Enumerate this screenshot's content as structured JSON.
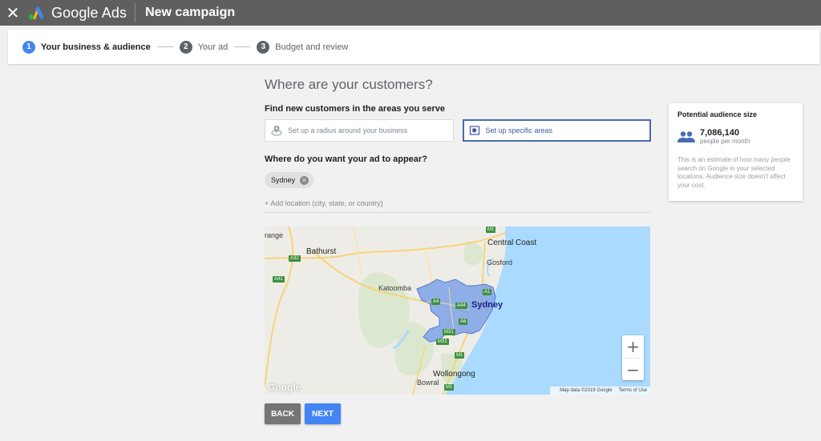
{
  "appbar": {
    "brand": "Google Ads",
    "title": "New campaign"
  },
  "stepper": {
    "steps": [
      {
        "num": "1",
        "label": "Your business & audience"
      },
      {
        "num": "2",
        "label": "Your ad"
      },
      {
        "num": "3",
        "label": "Budget and review"
      }
    ]
  },
  "main": {
    "title": "Where are your customers?",
    "find_heading": "Find new customers in the areas you serve",
    "option_radius": "Set up a radius around your business",
    "option_specific": "Set up specific areas",
    "where_heading": "Where do you want your ad to appear?",
    "chip_label": "Sydney",
    "add_location": "+ Add location (city, state, or country)"
  },
  "map": {
    "labels": {
      "range": "range",
      "bathurst": "Bathurst",
      "central_coast": "Central Coast",
      "gosford": "Gosford",
      "katoomba": "Katoomba",
      "sydney": "Sydney",
      "wollongong": "Wollongong",
      "bowral": "Bowral"
    },
    "shields": {
      "a32": "A32",
      "a41": "A41",
      "m1_top": "M1",
      "a1": "A1",
      "a4": "A4",
      "a44": "A44",
      "a6": "A6",
      "m31": "M31",
      "m31b": "M31",
      "m1": "M1",
      "m1b": "M1"
    },
    "zoom_in": "+",
    "zoom_out": "−",
    "attribution": "Map data ©2019 Google",
    "terms": "Terms of Use",
    "logo": "Google"
  },
  "buttons": {
    "back": "BACK",
    "next": "NEXT"
  },
  "audience": {
    "title": "Potential audience size",
    "number": "7,086,140",
    "unit": "people per month",
    "description": "This is an estimate of how many people search on Google in your selected locations. Audience size doesn't affect your cost."
  },
  "colors": {
    "appbar": "#5f5f5f",
    "accent": "#4285f4",
    "selected_border": "#4a6bb4",
    "water": "#aadaff"
  }
}
